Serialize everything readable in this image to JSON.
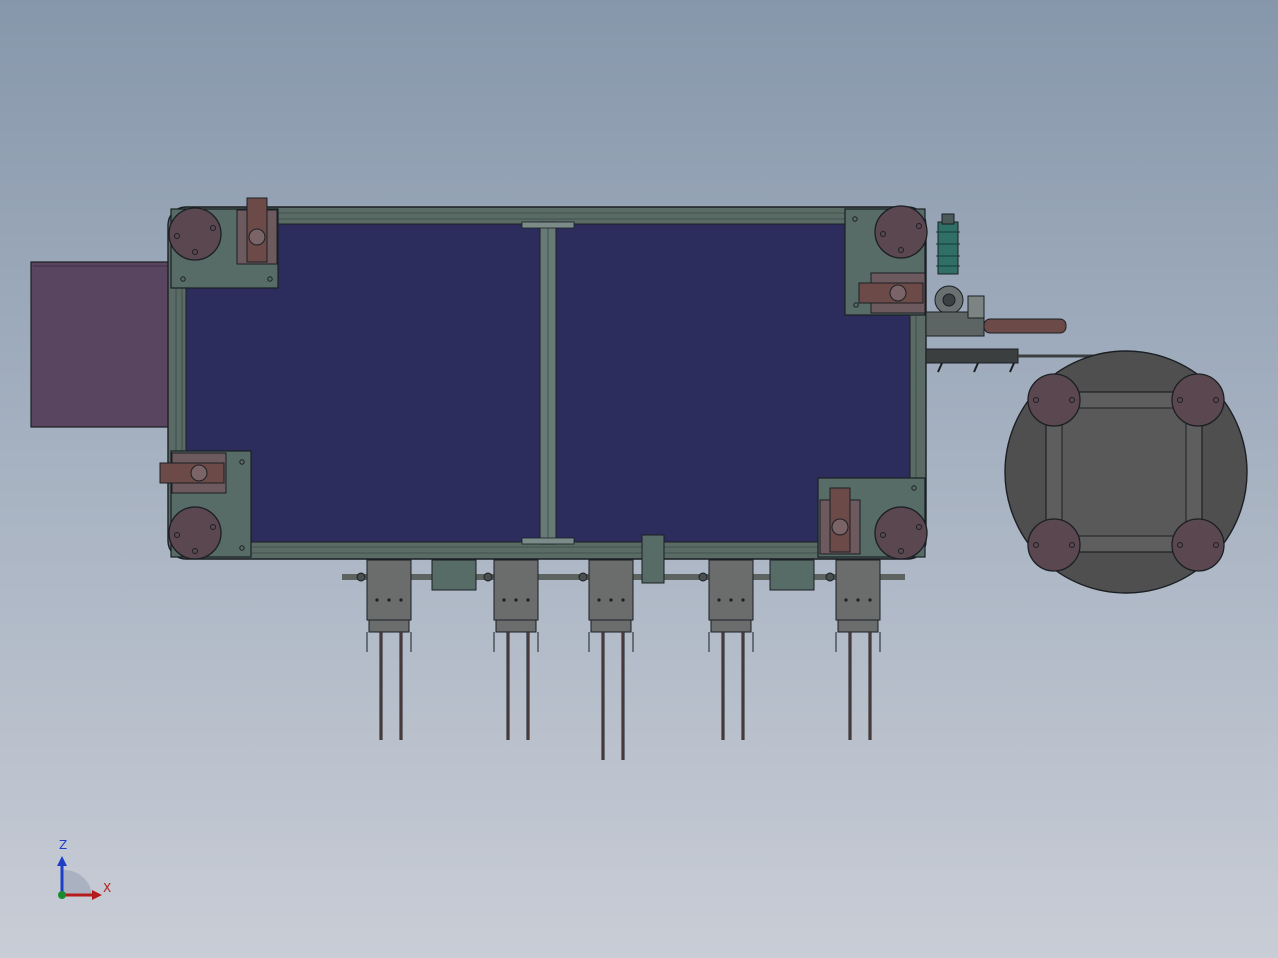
{
  "viewport": {
    "background_top": "#8797ab",
    "background_bottom": "#c9cdd6"
  },
  "colors": {
    "frame": "#5a6b66",
    "panel": "#2c2d5c",
    "plate": "#576b67",
    "foot": "#5a4750",
    "motor_box": "#5a4560",
    "outline": "#1b1f23",
    "hose": "#6b4a48",
    "valve": "#2f6f66",
    "turntable": "#4f4f4f",
    "turntable_inner": "#5e5e5e"
  },
  "triad": {
    "z_label": "Z",
    "x_label": "X",
    "z_color": "#1e3ec8",
    "x_color": "#b51b1b",
    "y_color": "#1a8a2e"
  }
}
